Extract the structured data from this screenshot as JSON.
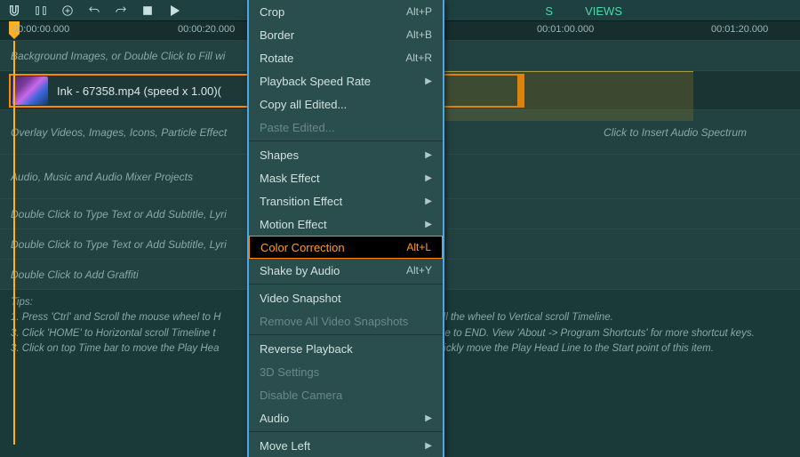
{
  "toolbar": {
    "tabs_partial": "S",
    "views_label": "VIEWS"
  },
  "ruler": {
    "t0": "00:00:00.000",
    "t1": "00:00:20.000",
    "t3": "00:01:00.000",
    "t4": "00:01:20.000"
  },
  "tracks": {
    "bg_hint": "Background Images, or Double Click to Fill wi",
    "clip_label": "Ink - 67358.mp4  (speed x 1.00)(",
    "overlay_hint_left": "Overlay Videos, Images, Icons, Particle Effect",
    "overlay_hint_right": "Click to Insert Audio Spectrum",
    "audio_hint": "Audio, Music and Audio Mixer Projects",
    "text_hint_1": "Double Click to Type Text or Add Subtitle, Lyri",
    "text_hint_2": "Double Click to Type Text or Add Subtitle, Lyri",
    "graffiti_hint": "Double Click to Add Graffiti"
  },
  "tips": {
    "heading": "Tips:",
    "l1a": "1. Press 'Ctrl' and Scroll the mouse wheel to H",
    "l1b": "roll the wheel to Vertical scroll Timeline.",
    "l2a": "3. Click 'HOME' to Horizontal scroll Timeline t",
    "l2b": "eline to END. View 'About -> Program Shortcuts' for more shortcut keys.",
    "l3a": "3. Click on top Time bar to move the Play Hea",
    "l3b": "quickly move the Play Head Line to the Start point of this item."
  },
  "menu": {
    "crop": "Crop",
    "crop_sc": "Alt+P",
    "border": "Border",
    "border_sc": "Alt+B",
    "rotate": "Rotate",
    "rotate_sc": "Alt+R",
    "speed": "Playback Speed Rate",
    "copy_edited": "Copy all Edited...",
    "paste_edited": "Paste Edited...",
    "shapes": "Shapes",
    "mask": "Mask Effect",
    "transition": "Transition Effect",
    "motion": "Motion Effect",
    "color": "Color Correction",
    "color_sc": "Alt+L",
    "shake": "Shake by Audio",
    "shake_sc": "Alt+Y",
    "snapshot": "Video Snapshot",
    "remove_snap": "Remove All Video Snapshots",
    "reverse": "Reverse Playback",
    "threed": "3D Settings",
    "disable_cam": "Disable Camera",
    "audio": "Audio",
    "move_left": "Move Left"
  }
}
